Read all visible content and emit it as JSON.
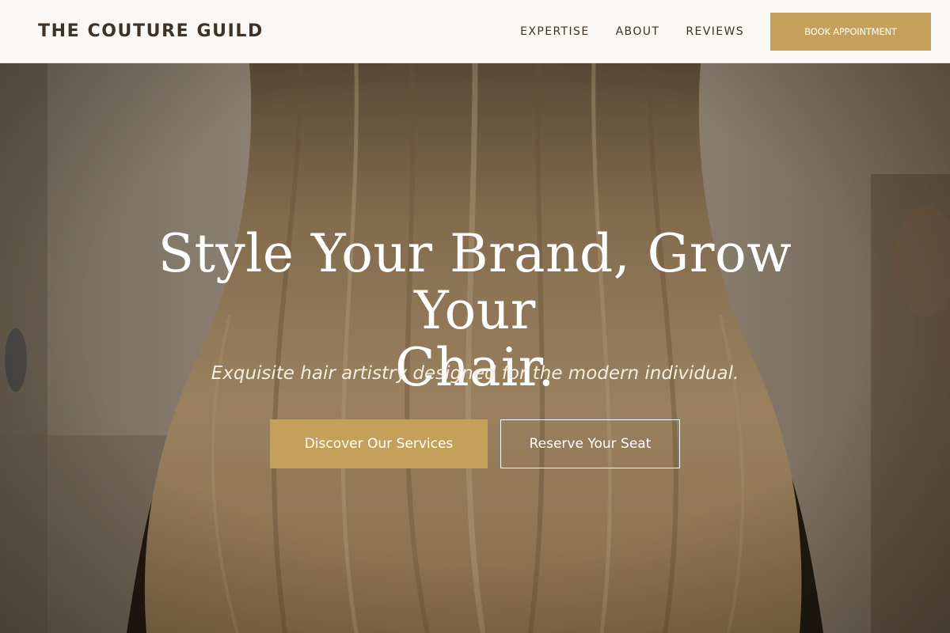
{
  "header": {
    "logo": "THE COUTURE GUILD",
    "nav": [
      {
        "label": "EXPERTISE"
      },
      {
        "label": "ABOUT"
      },
      {
        "label": "REVIEWS"
      }
    ],
    "cta_label": "BOOK APPOINTMENT"
  },
  "hero": {
    "title_line1": "Style Your Brand, Grow Your",
    "title_line2": "Chair.",
    "subtitle": "Exquisite hair artistry designed for the modern individual.",
    "primary_cta": "Discover Our Services",
    "secondary_cta": "Reserve Your Seat"
  },
  "colors": {
    "accent_gold": "#c4a05a",
    "header_bg": "#f9f8f4",
    "text_dark": "#3f3224"
  }
}
